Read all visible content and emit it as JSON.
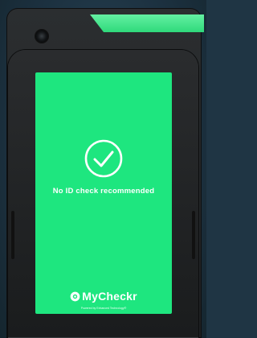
{
  "screen": {
    "status_text": "No ID check recommended",
    "status_icon": "checkmark-circle-icon",
    "background_color": "#1ee67f"
  },
  "brand": {
    "name": "MyCheckr",
    "tagline": "Powered by Enhanced Technology®",
    "logo_icon": "mycheckr-logo-icon"
  },
  "device": {
    "indicator_color": "#3ee58a",
    "body_color": "#222426"
  }
}
